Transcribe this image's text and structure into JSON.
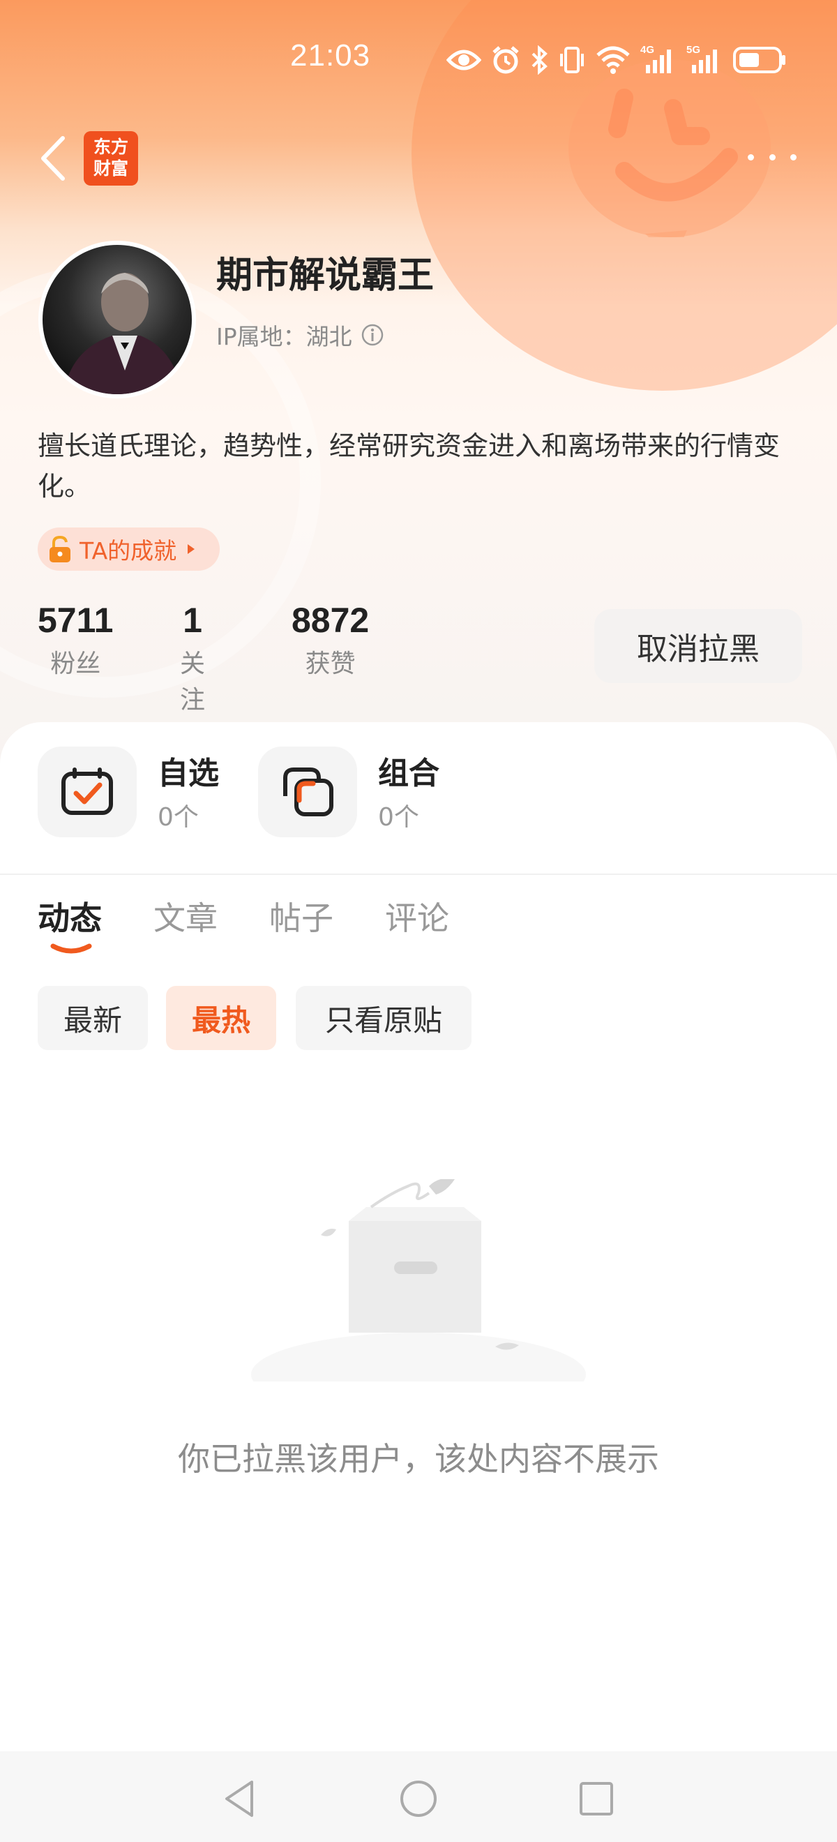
{
  "status_bar": {
    "time": "21:03",
    "icons": [
      "eye-icon",
      "alarm-icon",
      "bluetooth-icon",
      "vibrate-icon",
      "wifi-icon",
      "4g-signal-icon",
      "5g-signal-icon",
      "battery-icon"
    ],
    "net_4g": "4G",
    "net_5g": "5G"
  },
  "nav": {
    "back_icon": "chevron-left-icon",
    "logo_text_line1": "东方",
    "logo_text_line2": "财富",
    "more_icon": "more-dots-icon"
  },
  "profile": {
    "name": "期市解说霸王",
    "ip_location": "IP属地：湖北",
    "bio": "擅长道氏理论，趋势性，经常研究资金进入和离场带来的行情变化。",
    "achievement_label": "TA的成就"
  },
  "stats": [
    {
      "value": "5711",
      "label": "粉丝"
    },
    {
      "value": "1",
      "label": "关注"
    },
    {
      "value": "8872",
      "label": "获赞"
    }
  ],
  "unblock_button": "取消拉黑",
  "quick_items": [
    {
      "title": "自选",
      "count": "0个",
      "icon": "watchlist-check-icon"
    },
    {
      "title": "组合",
      "count": "0个",
      "icon": "portfolio-icon"
    }
  ],
  "tabs": [
    {
      "label": "动态",
      "active": true
    },
    {
      "label": "文章",
      "active": false
    },
    {
      "label": "帖子",
      "active": false
    },
    {
      "label": "评论",
      "active": false
    }
  ],
  "filters": [
    {
      "label": "最新",
      "active": false
    },
    {
      "label": "最热",
      "active": true
    },
    {
      "label": "只看原贴",
      "active": false
    }
  ],
  "empty_state": {
    "message": "你已拉黑该用户，该处内容不展示",
    "icon": "empty-box-icon"
  },
  "system_nav": [
    "back-triangle-icon",
    "home-circle-icon",
    "recents-square-icon"
  ],
  "colors": {
    "accent": "#f05a1e",
    "header_gradient_top": "#fb9a5e",
    "active_chip_bg": "#fee9df"
  }
}
